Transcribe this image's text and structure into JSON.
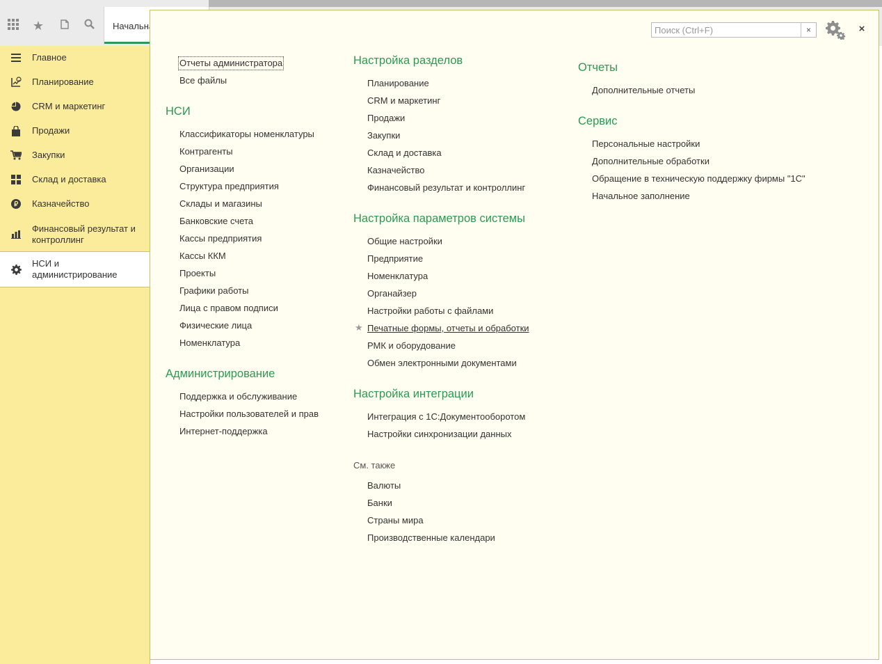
{
  "topbar": {
    "tab_home_label": "Начальная"
  },
  "sidebar": {
    "items": [
      {
        "label": "Главное",
        "icon": "menu-lines-icon"
      },
      {
        "label": "Планирование",
        "icon": "chart-dollar-icon"
      },
      {
        "label": "CRM и маркетинг",
        "icon": "pie-chart-icon"
      },
      {
        "label": "Продажи",
        "icon": "shopping-bag-icon"
      },
      {
        "label": "Закупки",
        "icon": "shopping-cart-icon"
      },
      {
        "label": "Склад и доставка",
        "icon": "warehouse-grid-icon"
      },
      {
        "label": "Казначейство",
        "icon": "ruble-coin-icon"
      },
      {
        "label": "Финансовый результат и контроллинг",
        "icon": "bar-chart-icon"
      },
      {
        "label": "НСИ и администрирование",
        "icon": "gear-icon"
      }
    ]
  },
  "search": {
    "placeholder": "Поиск (Ctrl+F)",
    "clear_label": "×"
  },
  "close_label": "×",
  "col1": {
    "top_links": [
      "Отчеты администратора",
      "Все файлы"
    ],
    "nsi": {
      "title": "НСИ",
      "links": [
        "Классификаторы номенклатуры",
        "Контрагенты",
        "Организации",
        "Структура предприятия",
        "Склады и магазины",
        "Банковские счета",
        "Кассы предприятия",
        "Кассы ККМ",
        "Проекты",
        "Графики работы",
        "Лица с правом подписи",
        "Физические лица",
        "Номенклатура"
      ]
    },
    "admin": {
      "title": "Администрирование",
      "links": [
        "Поддержка и обслуживание",
        "Настройки пользователей и прав",
        "Интернет-поддержка"
      ]
    }
  },
  "col2": {
    "sections_setup": {
      "title": "Настройка разделов",
      "links": [
        "Планирование",
        "CRM и маркетинг",
        "Продажи",
        "Закупки",
        "Склад и доставка",
        "Казначейство",
        "Финансовый результат и контроллинг"
      ]
    },
    "system_params": {
      "title": "Настройка параметров системы",
      "links": [
        "Общие настройки",
        "Предприятие",
        "Номенклатура",
        "Органайзер",
        "Настройки работы с файлами",
        "Печатные формы, отчеты и обработки",
        "РМК и оборудование",
        "Обмен электронными документами"
      ]
    },
    "integration": {
      "title": "Настройка интеграции",
      "links": [
        "Интеграция с 1С:Документооборотом",
        "Настройки синхронизации данных"
      ]
    },
    "see_also": {
      "title": "См. также",
      "links": [
        "Валюты",
        "Банки",
        "Страны мира",
        "Производственные календари"
      ]
    }
  },
  "col3": {
    "reports": {
      "title": "Отчеты",
      "links": [
        "Дополнительные отчеты"
      ]
    },
    "service": {
      "title": "Сервис",
      "links": [
        "Персональные настройки",
        "Дополнительные обработки",
        "Обращение в техническую поддержку фирмы \"1С\"",
        "Начальное заполнение"
      ]
    }
  }
}
